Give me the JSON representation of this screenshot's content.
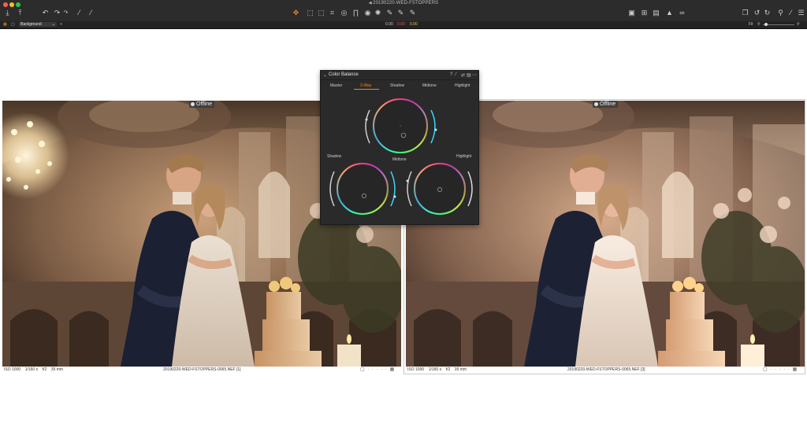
{
  "window": {
    "title": "20190220-WED-FSTOPPERS"
  },
  "toolbar": {
    "icons": [
      "import-icon",
      "export-icon",
      "undo-icon",
      "redo-icon",
      "redo-alt-icon",
      "magic-wand-icon",
      "picker-icon",
      "pan-tool-icon",
      "crop-tool-icon",
      "straighten-tool-icon",
      "keystone-tool-icon",
      "brush-tool-icon",
      "gradient-tool-icon",
      "heal-tool-icon",
      "clone-tool-icon",
      "erase-tool-icon",
      "picker2-tool-icon",
      "compare-icon",
      "grid-icon",
      "browser-icon",
      "warning-icon",
      "proof-icon",
      "copy-icon",
      "rotate-left-icon",
      "rotate-right-icon",
      "reset-icon",
      "adjust-icon",
      "list-icon"
    ]
  },
  "subbar": {
    "background_label": "Background",
    "value_1": "0.00",
    "value_2": "0.00",
    "value_3": "0.00",
    "zoom_label": "Fit"
  },
  "panel": {
    "title": "Color Balance",
    "tabs": [
      {
        "label": "Master",
        "active": false
      },
      {
        "label": "3-Way",
        "active": true
      },
      {
        "label": "Shadow",
        "active": false
      },
      {
        "label": "Midtone",
        "active": false
      },
      {
        "label": "Highlight",
        "active": false
      }
    ],
    "wheel_labels": {
      "shadow": "Shadow",
      "midtone": "Midtone",
      "highlight": "Highlight"
    },
    "header_icons": [
      "help-icon",
      "picker-icon",
      "copy-icon",
      "reset-icon",
      "more-icon"
    ]
  },
  "viewer": {
    "left": {
      "status": "Offline",
      "iso": "ISO 1000",
      "shutter": "1/160 s",
      "aperture": "f/2",
      "focal": "35 mm",
      "filename": "20190220-WED-FSTOPPERS-0065.NEF [1]"
    },
    "right": {
      "status": "Offline",
      "iso": "ISO 1000",
      "shutter": "1/160 s",
      "aperture": "f/2",
      "focal": "35 mm",
      "filename": "20190220-WED-FSTOPPERS-0065.NEF [3]"
    }
  },
  "colors": {
    "accent": "#e8892a",
    "toolbar": "#2c2c2c",
    "panel": "#2a2a2a"
  }
}
